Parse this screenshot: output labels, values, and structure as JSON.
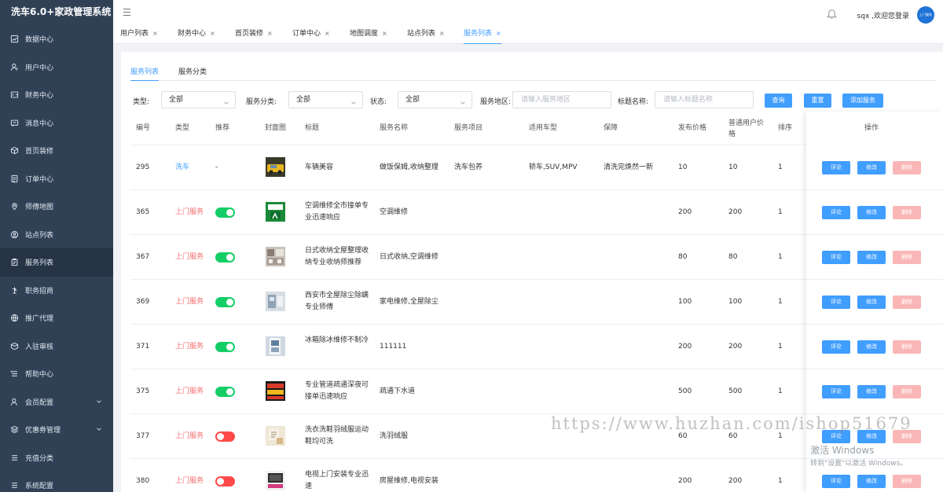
{
  "app": {
    "title": "洗车6.0+家政管理系统"
  },
  "sidebar": {
    "items": [
      {
        "label": "数据中心",
        "icon": "chart-icon"
      },
      {
        "label": "用户中心",
        "icon": "user-icon"
      },
      {
        "label": "财务中心",
        "icon": "wallet-icon"
      },
      {
        "label": "消息中心",
        "icon": "message-icon"
      },
      {
        "label": "首页装修",
        "icon": "cube-icon"
      },
      {
        "label": "订单中心",
        "icon": "order-icon"
      },
      {
        "label": "师傅地图",
        "icon": "location-icon"
      },
      {
        "label": "站点列表",
        "icon": "person-circle-icon"
      },
      {
        "label": "服务列表",
        "icon": "clipboard-icon",
        "active": true
      },
      {
        "label": "职务招商",
        "icon": "handshake-icon"
      },
      {
        "label": "推广代理",
        "icon": "globe-icon"
      },
      {
        "label": "入驻审核",
        "icon": "box-icon"
      },
      {
        "label": "帮助中心",
        "icon": "list-icon"
      },
      {
        "label": "会员配置",
        "icon": "member-icon",
        "expandable": true
      },
      {
        "label": "优惠券管理",
        "icon": "layers-icon",
        "expandable": true
      },
      {
        "label": "充值分类",
        "icon": "recharge-icon"
      },
      {
        "label": "系统配置",
        "icon": "settings-list-icon"
      }
    ]
  },
  "header": {
    "welcome": "sqx ,欢迎您登录",
    "avatar_text": "上门服务"
  },
  "tabs": [
    {
      "label": "用户列表"
    },
    {
      "label": "财务中心"
    },
    {
      "label": "首页装修"
    },
    {
      "label": "订单中心"
    },
    {
      "label": "地图调度"
    },
    {
      "label": "站点列表"
    },
    {
      "label": "服务列表",
      "active": true
    }
  ],
  "tab_close": "×",
  "subtabs": [
    {
      "label": "服务列表",
      "active": true
    },
    {
      "label": "服务分类"
    }
  ],
  "filters": {
    "type_label": "类型:",
    "type_value": "全部",
    "category_label": "服务分类:",
    "category_value": "全部",
    "status_label": "状态:",
    "status_value": "全部",
    "region_label": "服务地区:",
    "region_placeholder": "请输入服务地区",
    "title_label": "标题名称:",
    "title_placeholder": "请输入标题名称",
    "query_btn": "查询",
    "reset_btn": "重置",
    "add_btn": "添加服务"
  },
  "table": {
    "headers": {
      "id": "编号",
      "type": "类型",
      "recommend": "推荐",
      "cover": "封面图",
      "title": "标题",
      "service_name": "服务名称",
      "service_item": "服务项目",
      "car_type": "适用车型",
      "guarantee": "保障",
      "price": "发布价格",
      "user_price": "普通用户价格",
      "sort": "排序",
      "action": "操作"
    },
    "rows": [
      {
        "id": "295",
        "type": "洗车",
        "type_color": "#409eff",
        "recommend": "-",
        "switch": null,
        "title": "车辆美容",
        "service_name": "做饭保姆,收纳整理",
        "service_item": "洗车包养",
        "car_type": "轿车,SUV,MPV",
        "guarantee": "清洗完焕然一新",
        "price": "10",
        "user_price": "10",
        "sort": "1"
      },
      {
        "id": "365",
        "type": "上门服务",
        "type_color": "#f56c6c",
        "recommend": "",
        "switch": "on",
        "title": "空调维修全市接单专业迅速响应",
        "service_name": "空调维修",
        "service_item": "",
        "car_type": "",
        "guarantee": "",
        "price": "200",
        "user_price": "200",
        "sort": "1"
      },
      {
        "id": "367",
        "type": "上门服务",
        "type_color": "#f56c6c",
        "recommend": "",
        "switch": "on",
        "title": "日式收纳全屋整理收纳专业收纳师推荐",
        "service_name": "日式收纳,空调维修",
        "service_item": "",
        "car_type": "",
        "guarantee": "",
        "price": "80",
        "user_price": "80",
        "sort": "1"
      },
      {
        "id": "369",
        "type": "上门服务",
        "type_color": "#f56c6c",
        "recommend": "",
        "switch": "on",
        "title": "西安市全屋除尘除螨专业师傅",
        "service_name": "家电维修,全屋除尘",
        "service_item": "",
        "car_type": "",
        "guarantee": "",
        "price": "100",
        "user_price": "100",
        "sort": "1"
      },
      {
        "id": "371",
        "type": "上门服务",
        "type_color": "#f56c6c",
        "recommend": "",
        "switch": "on",
        "title": "冰箱除冰维修不制冷",
        "service_name": "111111",
        "service_item": "",
        "car_type": "",
        "guarantee": "",
        "price": "200",
        "user_price": "200",
        "sort": "1"
      },
      {
        "id": "375",
        "type": "上门服务",
        "type_color": "#f56c6c",
        "recommend": "",
        "switch": "on",
        "title": "专业管道疏通深夜可接单迅速响应",
        "service_name": "疏通下水道",
        "service_item": "",
        "car_type": "",
        "guarantee": "",
        "price": "500",
        "user_price": "500",
        "sort": "1"
      },
      {
        "id": "377",
        "type": "上门服务",
        "type_color": "#f56c6c",
        "recommend": "",
        "switch": "off",
        "title": "洗衣洗鞋羽绒服运动鞋均可洗",
        "service_name": "洗羽绒服",
        "service_item": "",
        "car_type": "",
        "guarantee": "",
        "price": "60",
        "user_price": "60",
        "sort": "1"
      },
      {
        "id": "380",
        "type": "上门服务",
        "type_color": "#f56c6c",
        "recommend": "",
        "switch": "off",
        "title": "电视上门安装专业迅速",
        "service_name": "房屋维修,电视安装",
        "service_item": "",
        "car_type": "",
        "guarantee": "",
        "price": "200",
        "user_price": "200",
        "sort": "1"
      }
    ],
    "actions": {
      "review": "评论",
      "edit": "修改",
      "delete": "删除"
    }
  },
  "watermark": "https://www.huzhan.com/ishop51679",
  "windows_activation": {
    "line1": "激活 Windows",
    "line2": "转到\"设置\"以激活 Windows。"
  },
  "colors": {
    "sidebar": "#304156",
    "primary": "#409eff",
    "danger": "#f56c6c",
    "switch_on": "#13ce66",
    "switch_off": "#ff4949"
  }
}
